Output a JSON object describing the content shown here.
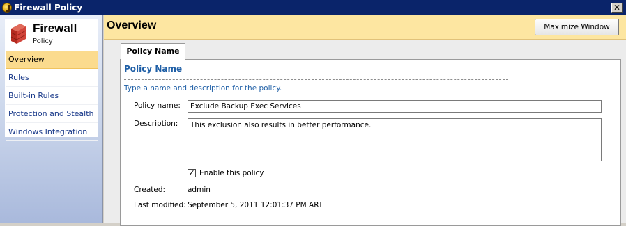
{
  "window": {
    "title": "Firewall Policy",
    "close_glyph": "✕"
  },
  "sidebar": {
    "brand_title": "Firewall",
    "brand_subtitle": "Policy",
    "brand_icon": "firewall-brick-icon",
    "items": [
      {
        "label": "Overview",
        "active": true
      },
      {
        "label": "Rules",
        "active": false
      },
      {
        "label": "Built-in Rules",
        "active": false
      },
      {
        "label": "Protection and Stealth",
        "active": false
      },
      {
        "label": "Windows Integration",
        "active": false
      }
    ]
  },
  "header": {
    "title": "Overview",
    "maximize_label": "Maximize Window",
    "background": "#fde6a1"
  },
  "tab": {
    "label": "Policy Name"
  },
  "section": {
    "title": "Policy Name",
    "description": "Type a name and description for the policy.",
    "accent_color": "#1f5fa6"
  },
  "form": {
    "name_label": "Policy name:",
    "name_value": "Exclude Backup Exec Services",
    "description_label": "Description:",
    "description_value": "This exclusion also results in better performance.",
    "enable_label": "Enable this policy",
    "enable_checked": true,
    "created_label": "Created:",
    "created_value": "admin",
    "modified_label": "Last modified:",
    "modified_value": "September 5, 2011 12:01:37 PM ART"
  }
}
